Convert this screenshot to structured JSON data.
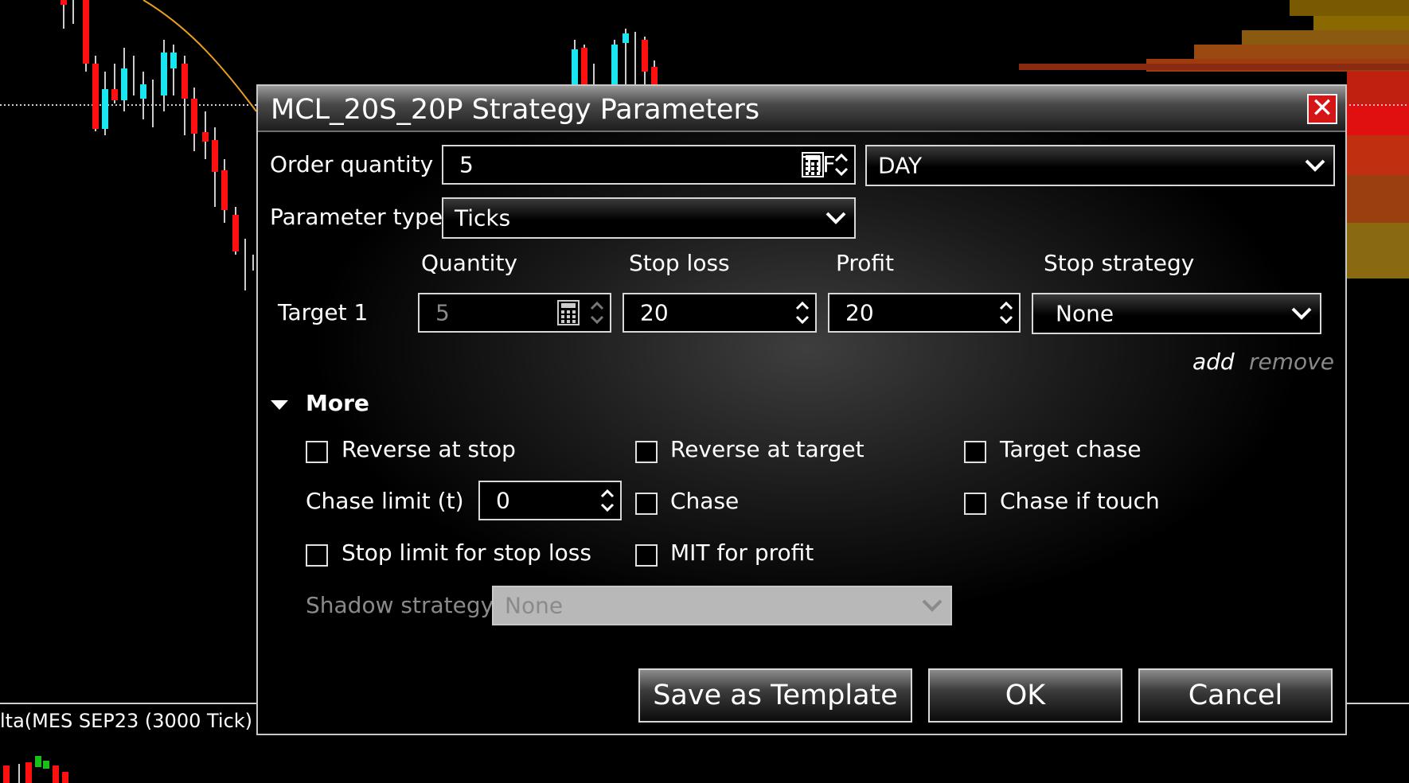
{
  "dialog": {
    "title": "MCL_20S_20P Strategy Parameters",
    "close_symbol": "✕"
  },
  "chart": {
    "indicator_label": "lta(MES SEP23 (3000 Tick)",
    "bullish_color": "#19e6f0",
    "bearish_color": "#ff1010",
    "ma_color": "#e8a020"
  },
  "order": {
    "quantity_label": "Order quantity",
    "quantity_value": "5",
    "tif_label": "TIF",
    "tif_value": "DAY",
    "param_type_label": "Parameter type",
    "param_type_value": "Ticks"
  },
  "targets": {
    "headers": {
      "quantity": "Quantity",
      "stop_loss": "Stop loss",
      "profit": "Profit",
      "stop_strategy": "Stop strategy"
    },
    "rows": [
      {
        "label": "Target 1",
        "quantity": "5",
        "stop_loss": "20",
        "profit": "20",
        "stop_strategy": "None"
      }
    ],
    "add_label": "add",
    "remove_label": "remove"
  },
  "more": {
    "label": "More",
    "reverse_at_stop": "Reverse at stop",
    "reverse_at_target": "Reverse at target",
    "target_chase": "Target chase",
    "chase_limit_label": "Chase limit (t)",
    "chase_limit_value": "0",
    "chase": "Chase",
    "chase_if_touch": "Chase if touch",
    "stop_limit_for_stop_loss": "Stop limit for stop loss",
    "mit_for_profit": "MIT for profit",
    "shadow_strategy_label": "Shadow strategy",
    "shadow_strategy_value": "None"
  },
  "buttons": {
    "save_template": "Save as Template",
    "ok": "OK",
    "cancel": "Cancel"
  }
}
